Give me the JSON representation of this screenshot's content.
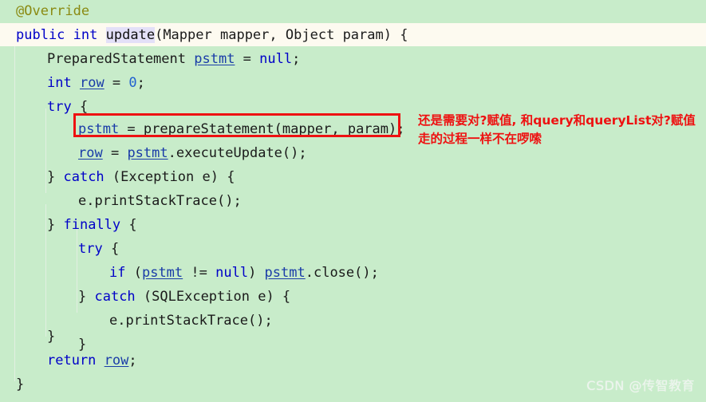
{
  "editor": {
    "background_color": "#c8ecca",
    "caret_line_color": "#fdfaf0",
    "selection_color": "#e3e0f8",
    "language": "java",
    "caret_line_index": 1,
    "lines": [
      {
        "indent": 1,
        "text": "@Override"
      },
      {
        "indent": 1,
        "text": "public int update(Mapper mapper, Object param) {"
      },
      {
        "indent": 2,
        "text": "PreparedStatement pstmt = null;"
      },
      {
        "indent": 2,
        "text": "int row = 0;"
      },
      {
        "indent": 2,
        "text": "try {"
      },
      {
        "indent": 3,
        "text": "pstmt = prepareStatement(mapper, param);"
      },
      {
        "indent": 3,
        "text": "row = pstmt.executeUpdate();"
      },
      {
        "indent": 2,
        "text": "} catch (Exception e) {"
      },
      {
        "indent": 3,
        "text": "e.printStackTrace();"
      },
      {
        "indent": 2,
        "text": "} finally {"
      },
      {
        "indent": 3,
        "text": "try {"
      },
      {
        "indent": 4,
        "text": "if (pstmt != null) pstmt.close();"
      },
      {
        "indent": 3,
        "text": "} catch (SQLException e) {"
      },
      {
        "indent": 4,
        "text": "e.printStackTrace();"
      },
      {
        "indent": 3,
        "text": "}"
      },
      {
        "indent": 2,
        "text": "}"
      },
      {
        "indent": 2,
        "text": "return row;"
      },
      {
        "indent": 1,
        "text": "}"
      }
    ],
    "tokens": {
      "l0": [
        {
          "t": "@Override",
          "c": "anno"
        }
      ],
      "l1": [
        {
          "t": "public",
          "c": "kw"
        },
        {
          "t": " ",
          "c": "plain"
        },
        {
          "t": "int",
          "c": "kw"
        },
        {
          "t": " ",
          "c": "plain"
        },
        {
          "t": "update",
          "c": "sel"
        },
        {
          "t": "(",
          "c": "plain"
        },
        {
          "t": "Mapper",
          "c": "type"
        },
        {
          "t": " ",
          "c": "plain"
        },
        {
          "t": "mapper",
          "c": "plain"
        },
        {
          "t": ", ",
          "c": "plain"
        },
        {
          "t": "Object",
          "c": "type"
        },
        {
          "t": " ",
          "c": "plain"
        },
        {
          "t": "param",
          "c": "plain"
        },
        {
          "t": ") {",
          "c": "plain"
        }
      ],
      "l2": [
        {
          "t": "PreparedStatement",
          "c": "type"
        },
        {
          "t": " ",
          "c": "plain"
        },
        {
          "t": "pstmt",
          "c": "fld"
        },
        {
          "t": " = ",
          "c": "plain"
        },
        {
          "t": "null",
          "c": "kw"
        },
        {
          "t": ";",
          "c": "plain"
        }
      ],
      "l3": [
        {
          "t": "int",
          "c": "kw"
        },
        {
          "t": " ",
          "c": "plain"
        },
        {
          "t": "row",
          "c": "fld"
        },
        {
          "t": " = ",
          "c": "plain"
        },
        {
          "t": "0",
          "c": "num"
        },
        {
          "t": ";",
          "c": "plain"
        }
      ],
      "l4": [
        {
          "t": "try",
          "c": "kw"
        },
        {
          "t": " {",
          "c": "plain"
        }
      ],
      "l5": [
        {
          "t": "pstmt",
          "c": "fld"
        },
        {
          "t": " = ",
          "c": "plain"
        },
        {
          "t": "prepareStatement",
          "c": "plain"
        },
        {
          "t": "(",
          "c": "plain"
        },
        {
          "t": "mapper",
          "c": "plain"
        },
        {
          "t": ", ",
          "c": "plain"
        },
        {
          "t": "param",
          "c": "plain"
        },
        {
          "t": ");",
          "c": "plain"
        }
      ],
      "l6": [
        {
          "t": "row",
          "c": "fld"
        },
        {
          "t": " = ",
          "c": "plain"
        },
        {
          "t": "pstmt",
          "c": "fld"
        },
        {
          "t": ".executeUpdate();",
          "c": "plain"
        }
      ],
      "l7": [
        {
          "t": "} ",
          "c": "plain"
        },
        {
          "t": "catch",
          "c": "kw"
        },
        {
          "t": " (",
          "c": "plain"
        },
        {
          "t": "Exception",
          "c": "type"
        },
        {
          "t": " e) {",
          "c": "plain"
        }
      ],
      "l8": [
        {
          "t": "e.printStackTrace();",
          "c": "plain"
        }
      ],
      "l9": [
        {
          "t": "} ",
          "c": "plain"
        },
        {
          "t": "finally",
          "c": "kw"
        },
        {
          "t": " {",
          "c": "plain"
        }
      ],
      "l10": [
        {
          "t": "try",
          "c": "kw"
        },
        {
          "t": " {",
          "c": "plain"
        }
      ],
      "l11": [
        {
          "t": "if",
          "c": "kw"
        },
        {
          "t": " (",
          "c": "plain"
        },
        {
          "t": "pstmt",
          "c": "fld"
        },
        {
          "t": " != ",
          "c": "plain"
        },
        {
          "t": "null",
          "c": "kw"
        },
        {
          "t": ") ",
          "c": "plain"
        },
        {
          "t": "pstmt",
          "c": "fld"
        },
        {
          "t": ".close();",
          "c": "plain"
        }
      ],
      "l12": [
        {
          "t": "} ",
          "c": "plain"
        },
        {
          "t": "catch",
          "c": "kw"
        },
        {
          "t": " (",
          "c": "plain"
        },
        {
          "t": "SQLException",
          "c": "type"
        },
        {
          "t": " e) {",
          "c": "plain"
        }
      ],
      "l13": [
        {
          "t": "e.printStackTrace();",
          "c": "plain"
        }
      ],
      "l14": [
        {
          "t": "}",
          "c": "plain"
        }
      ],
      "l15": [
        {
          "t": "}",
          "c": "plain"
        }
      ],
      "l16": [
        {
          "t": "return",
          "c": "kw"
        },
        {
          "t": " ",
          "c": "plain"
        },
        {
          "t": "row",
          "c": "fld"
        },
        {
          "t": ";",
          "c": "plain"
        }
      ],
      "l17": [
        {
          "t": "}",
          "c": "plain"
        }
      ]
    }
  },
  "annotation": {
    "color": "#ee1111",
    "line1": "还是需要对?赋值, 和query和queryList对?赋值",
    "line2": "走的过程一样不在啰嗦",
    "text": "还是需要对?赋值, 和query和queryList对?赋值\n走的过程一样不在啰嗦"
  },
  "highlight_box": {
    "color": "#ee1111",
    "target_line_text": "pstmt = prepareStatement(mapper, param);"
  },
  "watermark": {
    "text": "CSDN @传智教育"
  }
}
